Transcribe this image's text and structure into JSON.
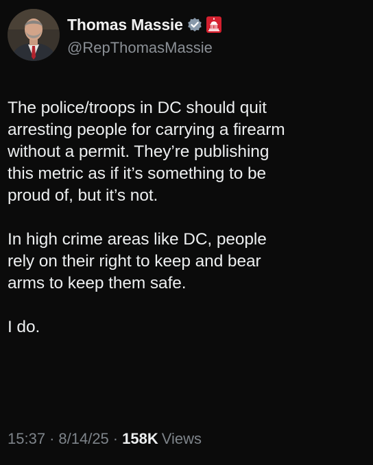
{
  "author": {
    "display_name": "Thomas Massie",
    "handle": "@RepThomasMassie",
    "verified_badge_icon": "verified-checkmark-icon",
    "affiliation_badge_icon": "capitol-dome-icon",
    "colors": {
      "verified": "#8899aa",
      "affiliation_badge": "#d4202f"
    }
  },
  "tweet": {
    "paragraphs": [
      "The police/troops in DC should quit\narresting people for carrying a firearm\nwithout a permit. They’re publishing\nthis metric as if it’s something to be\nproud of, but it’s not.",
      "In high crime areas like DC, people\nrely on their right to keep and bear\narms to keep them safe.",
      "I do."
    ]
  },
  "meta": {
    "time": "15:37",
    "separator": "·",
    "date": "8/14/25",
    "views_count": "158K",
    "views_label": "Views"
  }
}
